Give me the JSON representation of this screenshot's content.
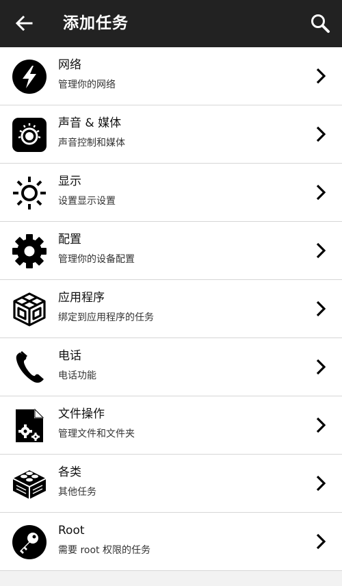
{
  "appbar": {
    "title": "添加任务",
    "back_icon": "arrow-left-icon",
    "search_icon": "search-icon"
  },
  "colors": {
    "appbar_bg": "#222222",
    "row_bg": "#ffffff",
    "icon": "#000000"
  },
  "items": [
    {
      "label": "网络",
      "subtitle": "管理你的网络",
      "icon": "lightning-icon"
    },
    {
      "label": "声音 & 媒体",
      "subtitle": "声音控制和媒体",
      "icon": "knob-icon"
    },
    {
      "label": "显示",
      "subtitle": "设置显示设置",
      "icon": "brightness-icon"
    },
    {
      "label": "配置",
      "subtitle": "管理你的设备配置",
      "icon": "gear-icon"
    },
    {
      "label": "应用程序",
      "subtitle": "绑定到应用程序的任务",
      "icon": "cube-icon"
    },
    {
      "label": "电话",
      "subtitle": "电话功能",
      "icon": "phone-icon"
    },
    {
      "label": "文件操作",
      "subtitle": "管理文件和文件夹",
      "icon": "file-gears-icon"
    },
    {
      "label": "各类",
      "subtitle": "其他任务",
      "icon": "brick-icon"
    },
    {
      "label": "Root",
      "subtitle": "需要 root 权限的任务",
      "icon": "key-icon"
    }
  ]
}
